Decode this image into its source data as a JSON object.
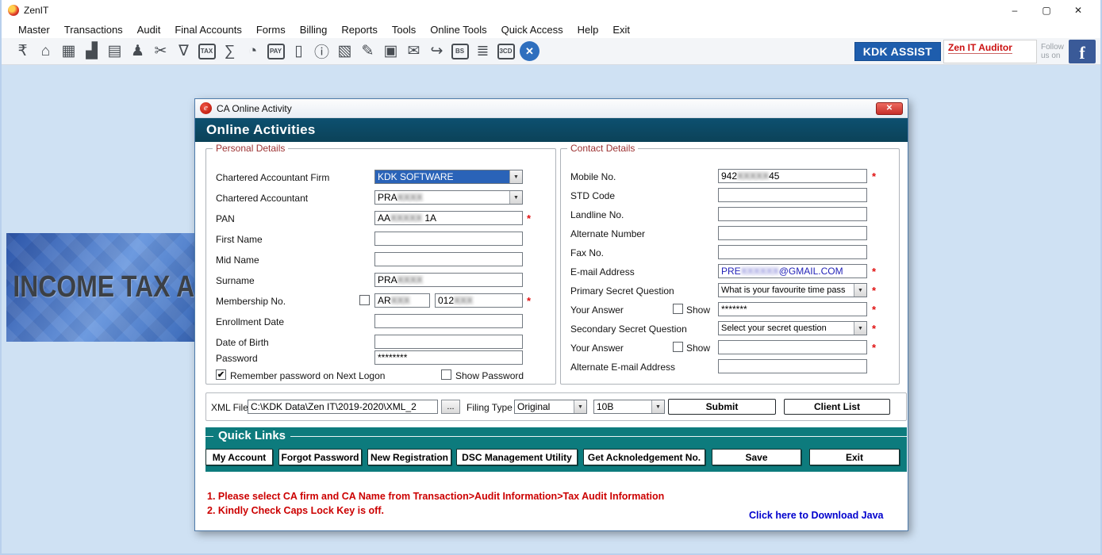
{
  "window": {
    "title": "ZenIT",
    "controls": {
      "minimize": "–",
      "maximize": "▢",
      "close": "✕"
    }
  },
  "menu": {
    "items": [
      "Master",
      "Transactions",
      "Audit",
      "Final Accounts",
      "Forms",
      "Billing",
      "Reports",
      "Tools",
      "Online Tools",
      "Quick Access",
      "Help",
      "Exit"
    ]
  },
  "toolbar": {
    "icons": [
      {
        "name": "rupee-challan-icon",
        "glyph": "₹",
        "style": "glyph"
      },
      {
        "name": "home-icon",
        "glyph": "⌂",
        "style": "glyph"
      },
      {
        "name": "company-info-icon",
        "glyph": "▦",
        "style": "glyph"
      },
      {
        "name": "mis-reports-icon",
        "glyph": "▟",
        "style": "glyph"
      },
      {
        "name": "manufacturing-icon",
        "glyph": "▤",
        "style": "glyph"
      },
      {
        "name": "client-master-icon",
        "glyph": "♟",
        "style": "glyph"
      },
      {
        "name": "tools-icon",
        "glyph": "✂",
        "style": "glyph"
      },
      {
        "name": "filter-icon",
        "glyph": "∇",
        "style": "glyph"
      },
      {
        "name": "tax-computation-icon",
        "glyph": "TAX",
        "style": "badge"
      },
      {
        "name": "calculator-icon",
        "glyph": "∑",
        "style": "glyph"
      },
      {
        "name": "pie-summary-icon",
        "glyph": "◔",
        "style": "glyph"
      },
      {
        "name": "e-payment-icon",
        "glyph": "PAY",
        "style": "badge"
      },
      {
        "name": "document-icon",
        "glyph": "▯",
        "style": "glyph"
      },
      {
        "name": "info-icon",
        "glyph": "ⓘ",
        "style": "glyph"
      },
      {
        "name": "abacus-icon",
        "glyph": "▧",
        "style": "glyph"
      },
      {
        "name": "data-entry-icon",
        "glyph": "✎",
        "style": "glyph"
      },
      {
        "name": "calendar-icon",
        "glyph": "▣",
        "style": "glyph"
      },
      {
        "name": "feedback-icon",
        "glyph": "✉",
        "style": "glyph"
      },
      {
        "name": "logout-icon",
        "glyph": "↪",
        "style": "glyph"
      },
      {
        "name": "balance-sheet-icon",
        "glyph": "BS",
        "style": "badge"
      },
      {
        "name": "bank-icon",
        "glyph": "≣",
        "style": "glyph"
      },
      {
        "name": "form-3cd-icon",
        "glyph": "3CD",
        "style": "badge"
      },
      {
        "name": "close-app-icon",
        "glyph": "✕",
        "style": "close"
      }
    ],
    "kdk_assist_label": "KDK ASSIST",
    "auditor_label": "Zen IT Auditor",
    "follow_line1": "Follow",
    "follow_line2": "us on",
    "facebook_glyph": "f"
  },
  "banner": {
    "text": "INCOME TAX A"
  },
  "misc": {
    "required": "*",
    "dropdown_arrow": "▼",
    "check_glyph": "✔"
  },
  "colors": {
    "header_blue": "#0d5070",
    "quicklinks_teal": "#0d7b7d",
    "kdk_blue": "#1e5dad",
    "alert_red": "#cc0000",
    "link_blue": "#0000cd",
    "required_red": "#e01010",
    "highlight_blue": "#2a63b8",
    "app_bg": "#cfe1f3"
  },
  "dialog": {
    "titlebar": {
      "title": "CA Online Activity",
      "logo_glyph": "e",
      "close_glyph": "✕"
    },
    "header": "Online Activities",
    "personal": {
      "title": "Personal Details",
      "labels": {
        "firm": "Chartered Accountant Firm",
        "ca": "Chartered Accountant",
        "pan": "PAN",
        "first_name": "First Name",
        "mid_name": "Mid Name",
        "surname": "Surname",
        "membership": "Membership No.",
        "enrollment": "Enrollment Date",
        "dob": "Date of Birth",
        "password": "Password",
        "remember": "Remember password on Next Logon",
        "show_password": "Show Password"
      },
      "values": {
        "firm": "KDK SOFTWARE",
        "ca_prefix": "PRA",
        "ca_masked": "XXXX",
        "pan_prefix": "AA",
        "pan_masked": "XXXXX",
        "pan_suffix": " 1A",
        "first_name": "",
        "mid_name": "",
        "surname_prefix": "PRA",
        "surname_masked": "XXXX",
        "mem1_prefix": "AR",
        "mem1_masked": "XXX",
        "mem2_prefix": "012",
        "mem2_masked": "XXX",
        "enrollment": "",
        "dob": "",
        "password": "********"
      }
    },
    "contact": {
      "title": "Contact Details",
      "labels": {
        "mobile": "Mobile No.",
        "std": "STD Code",
        "landline": "Landline No.",
        "alt_number": "Alternate Number",
        "fax": "Fax No.",
        "email": "E-mail Address",
        "primary_q": "Primary Secret Question",
        "answer1": "Your Answer",
        "show1": "Show",
        "secondary_q": "Secondary Secret Question",
        "answer2": "Your Answer",
        "show2": "Show",
        "alt_email": "Alternate E-mail Address"
      },
      "values": {
        "mobile_prefix": "942",
        "mobile_masked": "XXXXX",
        "mobile_suffix": "45",
        "std": "",
        "landline": "",
        "alt_number": "",
        "fax": "",
        "email_prefix": "PRE",
        "email_masked": "XXXXXX",
        "email_suffix": "@GMAIL.COM",
        "primary_q": "What is your favourite time pass",
        "answer1": "*******",
        "secondary_q": "Select your secret question",
        "answer2": "",
        "alt_email": ""
      }
    },
    "xml_row": {
      "label": "XML File",
      "path": "C:\\KDK Data\\Zen IT\\2019-2020\\XML_2",
      "browse": "...",
      "filing_type_label": "Filing Type",
      "filing_type": "Original",
      "form_type": "10B",
      "submit": "Submit",
      "client_list": "Client List"
    },
    "quick_links": {
      "title": "Quick Links",
      "buttons": [
        "My Account",
        "Forgot Password",
        "New Registration",
        "DSC Management Utility",
        "Get Acknoledgement No.",
        "Save",
        "Exit"
      ]
    },
    "notes": [
      "1. Please select CA firm and CA Name from Transaction>Audit Information>Tax Audit Information",
      "2. Kindly Check Caps Lock Key is off."
    ],
    "java_link": "Click here to Download Java"
  }
}
